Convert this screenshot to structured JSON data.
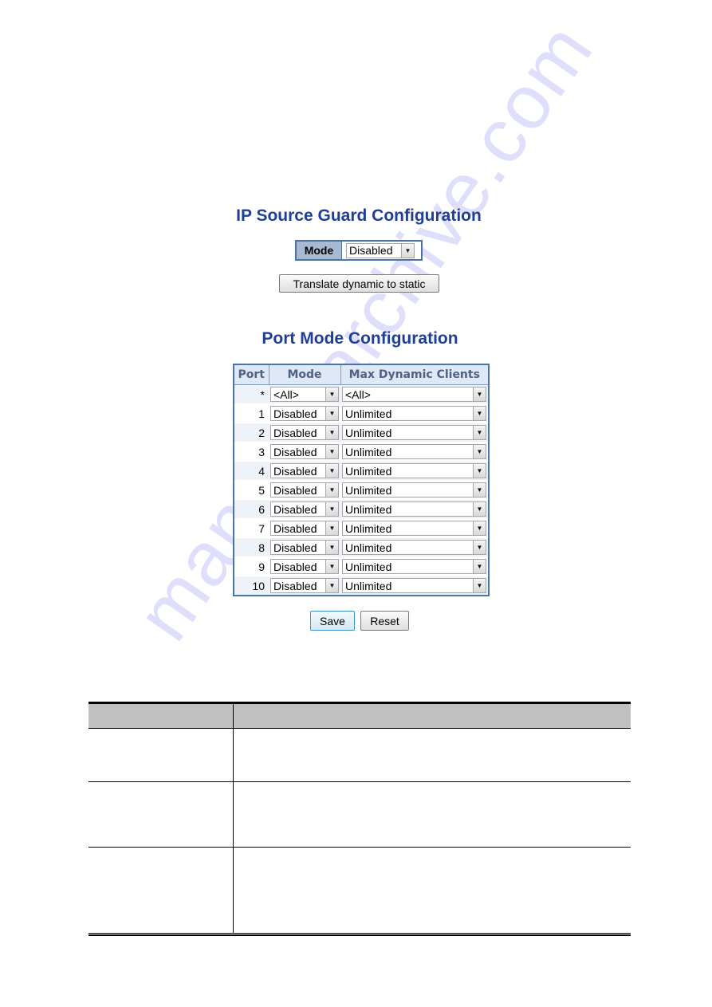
{
  "watermark": "manualsarchive.com",
  "ip_source_guard": {
    "title": "IP Source Guard Configuration",
    "mode_label": "Mode",
    "mode_value": "Disabled",
    "translate_button": "Translate dynamic to static"
  },
  "port_mode": {
    "title": "Port Mode Configuration",
    "columns": [
      "Port",
      "Mode",
      "Max Dynamic Clients"
    ],
    "rows": [
      {
        "port": "*",
        "mode": "<All>",
        "max": "<All>"
      },
      {
        "port": "1",
        "mode": "Disabled",
        "max": "Unlimited"
      },
      {
        "port": "2",
        "mode": "Disabled",
        "max": "Unlimited"
      },
      {
        "port": "3",
        "mode": "Disabled",
        "max": "Unlimited"
      },
      {
        "port": "4",
        "mode": "Disabled",
        "max": "Unlimited"
      },
      {
        "port": "5",
        "mode": "Disabled",
        "max": "Unlimited"
      },
      {
        "port": "6",
        "mode": "Disabled",
        "max": "Unlimited"
      },
      {
        "port": "7",
        "mode": "Disabled",
        "max": "Unlimited"
      },
      {
        "port": "8",
        "mode": "Disabled",
        "max": "Unlimited"
      },
      {
        "port": "9",
        "mode": "Disabled",
        "max": "Unlimited"
      },
      {
        "port": "10",
        "mode": "Disabled",
        "max": "Unlimited"
      }
    ]
  },
  "buttons": {
    "save": "Save",
    "reset": "Reset"
  },
  "colors": {
    "heading": "#1f3f97",
    "table_border": "#4a74a8",
    "header_bg": "#dfe8f6"
  }
}
